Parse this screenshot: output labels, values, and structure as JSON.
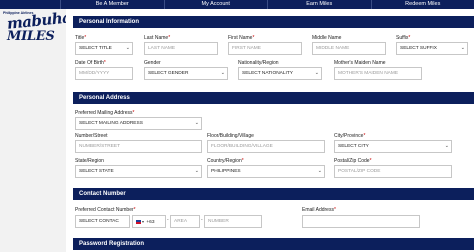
{
  "nav": {
    "items": [
      "Be A Member",
      "My Account",
      "Earn Miles",
      "Redeem Miles"
    ]
  },
  "logo": {
    "small": "Philippine Airlines",
    "main": "mabuhay",
    "sub": "MILES"
  },
  "sections": {
    "personal_info": "Personal Information",
    "personal_address": "Personal Address",
    "contact_number": "Contact Number",
    "password_registration": "Password Registration"
  },
  "personal": {
    "title_label": "Title",
    "title_value": "SELECT TITLE",
    "last_name_label": "Last Name",
    "last_name_placeholder": "LAST NAME",
    "first_name_label": "First Name",
    "first_name_placeholder": "FIRST NAME",
    "middle_name_label": "Middle Name",
    "middle_name_placeholder": "MIDDLE NAME",
    "suffix_label": "Suffix",
    "suffix_value": "SELECT SUFFIX",
    "dob_label": "Date Of Birth",
    "dob_placeholder": "MM/DD/YYYY",
    "gender_label": "Gender",
    "gender_value": "SELECT GENDER",
    "nationality_label": "Nationality/Region",
    "nationality_value": "SELECT NATIONALITY",
    "mothers_label": "Mother's Maiden Name",
    "mothers_placeholder": "MOTHER'S MAIDEN NAME"
  },
  "address": {
    "mailing_label": "Preferred Mailing Address",
    "mailing_value": "SELECT MAILING ADDRESS",
    "number_label": "Number/Street",
    "number_placeholder": "NUMBER/STREET",
    "floor_label": "Floor/Building/Village",
    "floor_placeholder": "FLOOR/BUILDING/VILLAGE",
    "city_label": "City/Province",
    "city_value": "SELECT CITY",
    "state_label": "State/Region",
    "state_value": "SELECT STATE",
    "country_label": "Country/Region",
    "country_value": "PHILIPPINES",
    "postal_label": "Postal/Zip Code",
    "postal_placeholder": "POSTAL/ZIP CODE"
  },
  "contact": {
    "preferred_label": "Preferred Contact Number",
    "preferred_value": "SELECT CONTAC",
    "country_code": "+63",
    "area_placeholder": "AREA",
    "number_placeholder": "NUMBER",
    "email_label": "Email Address"
  },
  "colors": {
    "navy": "#0c1f5c",
    "required": "#cc0000"
  }
}
